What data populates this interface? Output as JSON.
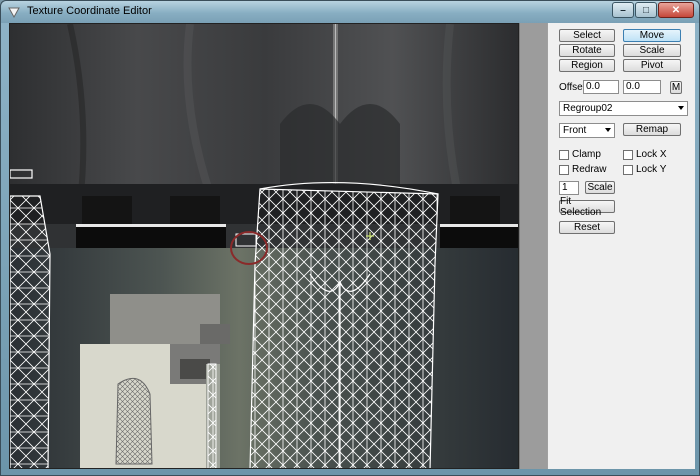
{
  "window": {
    "title": "Texture Coordinate Editor",
    "minimize": "–",
    "maximize": "□",
    "close": "✕"
  },
  "tools": {
    "select": "Select",
    "move": "Move",
    "rotate": "Rotate",
    "scale": "Scale",
    "region": "Region",
    "pivot": "Pivot"
  },
  "offset": {
    "label": "Offset:",
    "x": "0.0",
    "y": "0.0",
    "m_button": "M"
  },
  "group_select": {
    "value": "Regroup02"
  },
  "view_select": {
    "value": "Front"
  },
  "remap_button": "Remap",
  "options": {
    "clamp": "Clamp",
    "redraw": "Redraw",
    "lock_x": "Lock X",
    "lock_y": "Lock Y"
  },
  "scale_value": "1",
  "scale_button": "Scale",
  "fit_selection_button": "Fit Selection",
  "reset_button": "Reset",
  "colors": {
    "accent": "#3c7fb1",
    "annotation": "#8a2a2a",
    "wireframe": "#ffffff"
  }
}
